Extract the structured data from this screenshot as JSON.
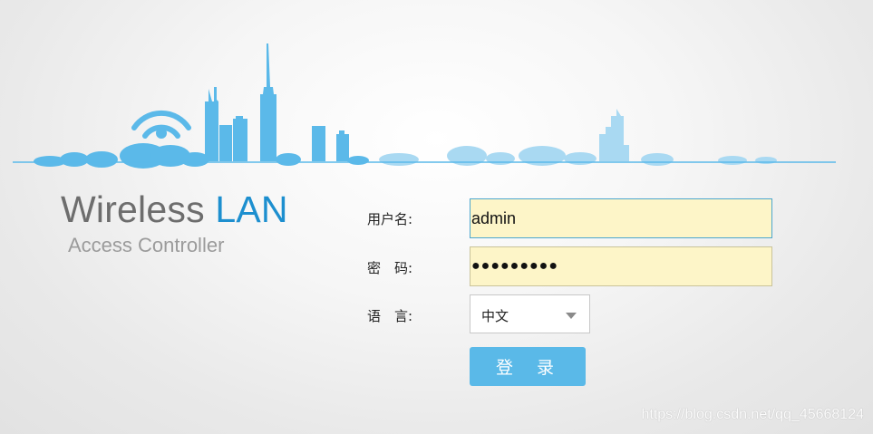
{
  "brand": {
    "title_main": "Wireless",
    "title_accent": "LAN",
    "subtitle": "Access Controller"
  },
  "form": {
    "username_label": "用户名:",
    "username_value": "admin",
    "password_label": "密　码:",
    "password_value": "●●●●●●●●●",
    "language_label": "语　言:",
    "language_value": "中文",
    "login_label": "登 录"
  },
  "watermark": "https://blog.csdn.net/qq_45668124",
  "colors": {
    "skyline_blue": "#5bb9e9",
    "skyline_light": "#a9d9f2",
    "accent": "#1d8fcf",
    "button": "#5ab9e8",
    "input_bg": "#fdf5c8"
  }
}
